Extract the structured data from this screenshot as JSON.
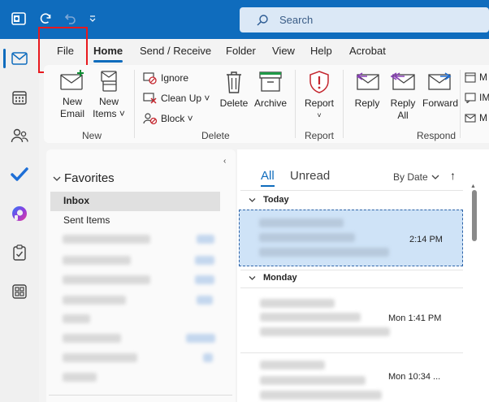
{
  "search": {
    "placeholder": "Search"
  },
  "tabs": [
    "File",
    "Home",
    "Send / Receive",
    "Folder",
    "View",
    "Help",
    "Acrobat"
  ],
  "ribbon": {
    "new_email": [
      "New",
      "Email"
    ],
    "new_items": [
      "New",
      "Items ˅"
    ],
    "new_group": "New",
    "ignore": "Ignore",
    "cleanup": "Clean Up ˅",
    "block": "Block ˅",
    "delete": "Delete",
    "archive": "Archive",
    "delete_group": "Delete",
    "report": "Report",
    "report_group": "Report",
    "reply": "Reply",
    "reply_all": [
      "Reply",
      "All"
    ],
    "forward": "Forward",
    "respond_group": "Respond",
    "more": [
      "M",
      "IM",
      "M"
    ]
  },
  "folders": {
    "favorites": "Favorites",
    "inbox": "Inbox",
    "sent": "Sent Items"
  },
  "messages": {
    "tab_all": "All",
    "tab_unread": "Unread",
    "sort": "By Date",
    "group_today": "Today",
    "group_monday": "Monday",
    "time1": "2:14 PM",
    "time2": "Mon 1:41 PM",
    "time3": "Mon 10:34 ..."
  },
  "colors": {
    "accent": "#0f6cbd",
    "highlight": "#e8191e",
    "selected": "#cfe3f7"
  }
}
